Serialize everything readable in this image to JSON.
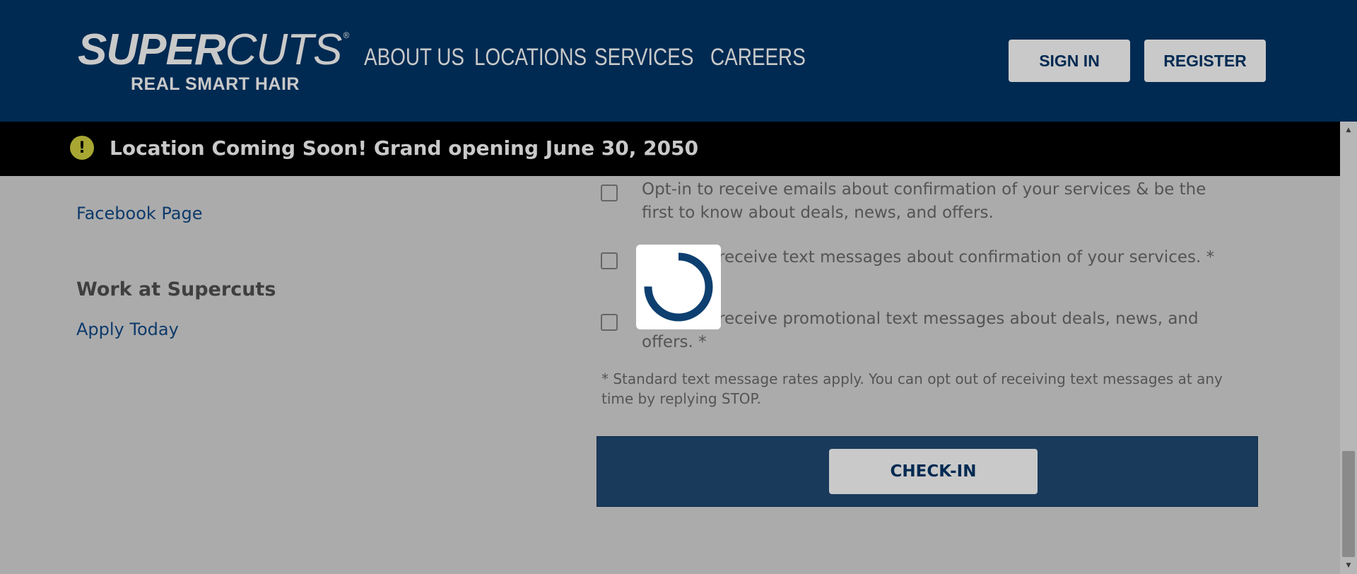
{
  "header": {
    "logo": {
      "bold": "SUPER",
      "light": "CUTS",
      "reg": "®",
      "tagline": "REAL SMART HAIR"
    },
    "nav": [
      "ABOUT US",
      "LOCATIONS",
      "SERVICES",
      "CAREERS"
    ],
    "sign_in": "SIGN IN",
    "register": "REGISTER"
  },
  "banner": {
    "icon": "exclamation-icon",
    "text": "Location Coming Soon! Grand opening June 30, 2050"
  },
  "left": {
    "facebook_link": "Facebook Page",
    "work_heading": "Work at Supercuts",
    "apply_link": "Apply Today"
  },
  "form": {
    "options": [
      {
        "text": "Opt-in to receive emails about confirmation of your services & be the first to know about deals, news, and offers."
      },
      {
        "text_visible": "receive text messages about confirmation of your services. *"
      },
      {
        "text_visible_line1": "receive promotional text messages about deals, news, and",
        "text_visible_line2": "offers. *"
      }
    ],
    "disclaimer": "* Standard text message rates apply. You can opt out of receiving text messages at any time by replying STOP.",
    "checkin_label": "CHECK-IN"
  },
  "colors": {
    "header_bg": "#002a52",
    "banner_bg": "#000000",
    "alert_icon": "#a8a733",
    "page_bg": "#ababab",
    "checkin_panel": "#1a3a5c",
    "spinner": "#0d3f70"
  }
}
